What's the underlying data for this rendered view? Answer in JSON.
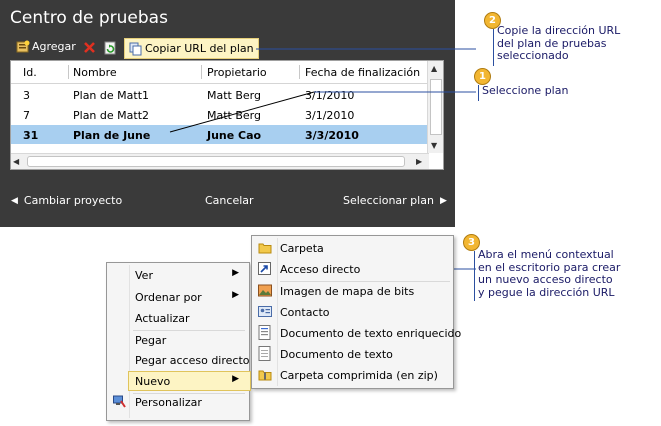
{
  "panel": {
    "title": "Centro de pruebas",
    "add_label": "Agregar",
    "copy_url_label": "Copiar URL del plan",
    "columns": [
      "Id.",
      "Nombre",
      "Propietario",
      "Fecha de finalización"
    ],
    "rows": [
      {
        "id": "3",
        "name": "Plan de Matt1",
        "owner": "Matt Berg",
        "date": "3/1/2010",
        "selected": false
      },
      {
        "id": "7",
        "name": "Plan de Matt2",
        "owner": "Matt Berg",
        "date": "3/1/2010",
        "selected": false
      },
      {
        "id": "31",
        "name": "Plan de June",
        "owner": "June Cao",
        "date": "3/3/2010",
        "selected": true
      }
    ],
    "change_project": "Cambiar proyecto",
    "cancel": "Cancelar",
    "select_plan": "Seleccionar plan"
  },
  "callouts": [
    {
      "number": "2",
      "lines": [
        "Copie la dirección URL",
        "del plan de pruebas",
        "seleccionado"
      ]
    },
    {
      "number": "1",
      "lines": [
        "Seleccione plan"
      ]
    },
    {
      "number": "3",
      "lines": [
        "Abra el menú contextual",
        "en el escritorio para crear",
        "un nuevo acceso directo",
        "y pegue la dirección URL"
      ]
    }
  ],
  "context_menu": {
    "items": [
      {
        "label": "Ver",
        "submenu": true
      },
      {
        "label": "Ordenar por",
        "submenu": true
      },
      {
        "label": "Actualizar",
        "submenu": false
      },
      {
        "label": "Pegar",
        "submenu": false
      },
      {
        "label": "Pegar acceso directo",
        "submenu": false
      },
      {
        "label": "Nuevo",
        "submenu": true
      },
      {
        "label": "Personalizar",
        "submenu": false
      }
    ]
  },
  "new_submenu": {
    "items": [
      {
        "label": "Carpeta",
        "icon": "folder-icon"
      },
      {
        "label": "Acceso directo",
        "icon": "shortcut-icon"
      },
      {
        "label": "Imagen de mapa de bits",
        "icon": "bitmap-icon"
      },
      {
        "label": "Contacto",
        "icon": "contact-icon"
      },
      {
        "label": "Documento de texto enriquecido",
        "icon": "rich-text-doc-icon"
      },
      {
        "label": "Documento de texto",
        "icon": "text-doc-icon"
      },
      {
        "label": "Carpeta comprimida (en zip)",
        "icon": "zip-folder-icon"
      }
    ]
  },
  "colors": {
    "panel_bg": "#3a3a3a",
    "selection": "#a8cff0",
    "highlight": "#fdf4c4",
    "badge": "#f2b632",
    "callout_line": "#2b4fa0"
  }
}
